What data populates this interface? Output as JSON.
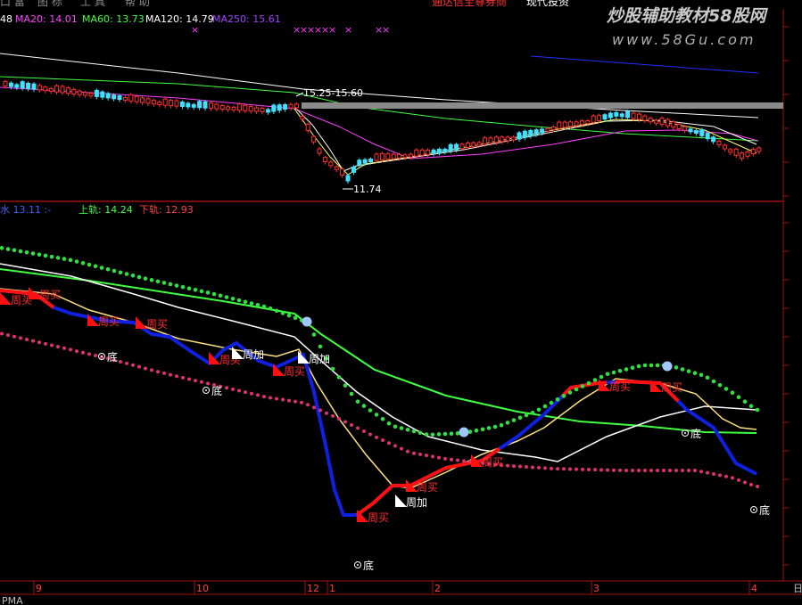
{
  "menu": {
    "items": [
      "口 富",
      "图 标",
      "工 具",
      "帮 助"
    ],
    "center_text": "通达信至尊券商",
    "center_text2": "现代投资",
    "watermark_title": "炒股辅助教材58股网",
    "watermark_url": "www.58Gu.com"
  },
  "top_panel": {
    "indicators": [
      {
        "label": "48",
        "color": "#ffffff"
      },
      {
        "label": "MA20: 14.01",
        "color": "#ff40ff"
      },
      {
        "label": "MA60: 13.73",
        "color": "#40ff40"
      },
      {
        "label": "MA120: 14.79",
        "color": "#ffffff"
      },
      {
        "label": "MA250: 15.61",
        "color": "#a040ff"
      }
    ],
    "annotation_high": "15.25-15.60",
    "annotation_low": "11.74",
    "marker_glyph": "×"
  },
  "bottom_panel": {
    "indicators": [
      {
        "label": "水 13.11 :-",
        "color": "#4060ff"
      },
      {
        "label": "上轨: 14.24",
        "color": "#40ff40"
      },
      {
        "label": "下轨: 12.93",
        "color": "#ff4040"
      }
    ],
    "signal_buy": "周买",
    "signal_add": "周加",
    "signal_bottom": "底"
  },
  "x_axis": {
    "labels": [
      "9",
      "10",
      "12",
      "1",
      "2",
      "3",
      "4"
    ]
  },
  "status": {
    "tab_label": "PMA",
    "corner_label": "日"
  },
  "chart_data": {
    "type": "line",
    "title": "",
    "xlabel": "",
    "ylabel": "",
    "x_axis_labels": [
      "9",
      "10",
      "12",
      "1",
      "2",
      "3",
      "4"
    ],
    "top_panel": {
      "type": "candlestick",
      "series": [
        {
          "name": "MA20",
          "value": 14.01,
          "color": "#ff40ff"
        },
        {
          "name": "MA60",
          "value": 13.73,
          "color": "#40ff40"
        },
        {
          "name": "MA120",
          "value": 14.79,
          "color": "#ffffff"
        },
        {
          "name": "MA250",
          "value": 15.61,
          "color": "#a040ff"
        }
      ],
      "annotations": [
        {
          "text": "15.25-15.60",
          "price": 15.25
        },
        {
          "text": "11.74",
          "price": 11.74
        }
      ]
    },
    "bottom_panel": {
      "series": [
        {
          "name": "上轨",
          "value": 14.24,
          "color": "#40ff40"
        },
        {
          "name": "下轨",
          "value": 12.93,
          "color": "#ff4040"
        }
      ],
      "signals": [
        {
          "type": "周买",
          "count": 10
        },
        {
          "type": "周加",
          "count": 3
        },
        {
          "type": "底",
          "count": 5
        }
      ]
    }
  }
}
